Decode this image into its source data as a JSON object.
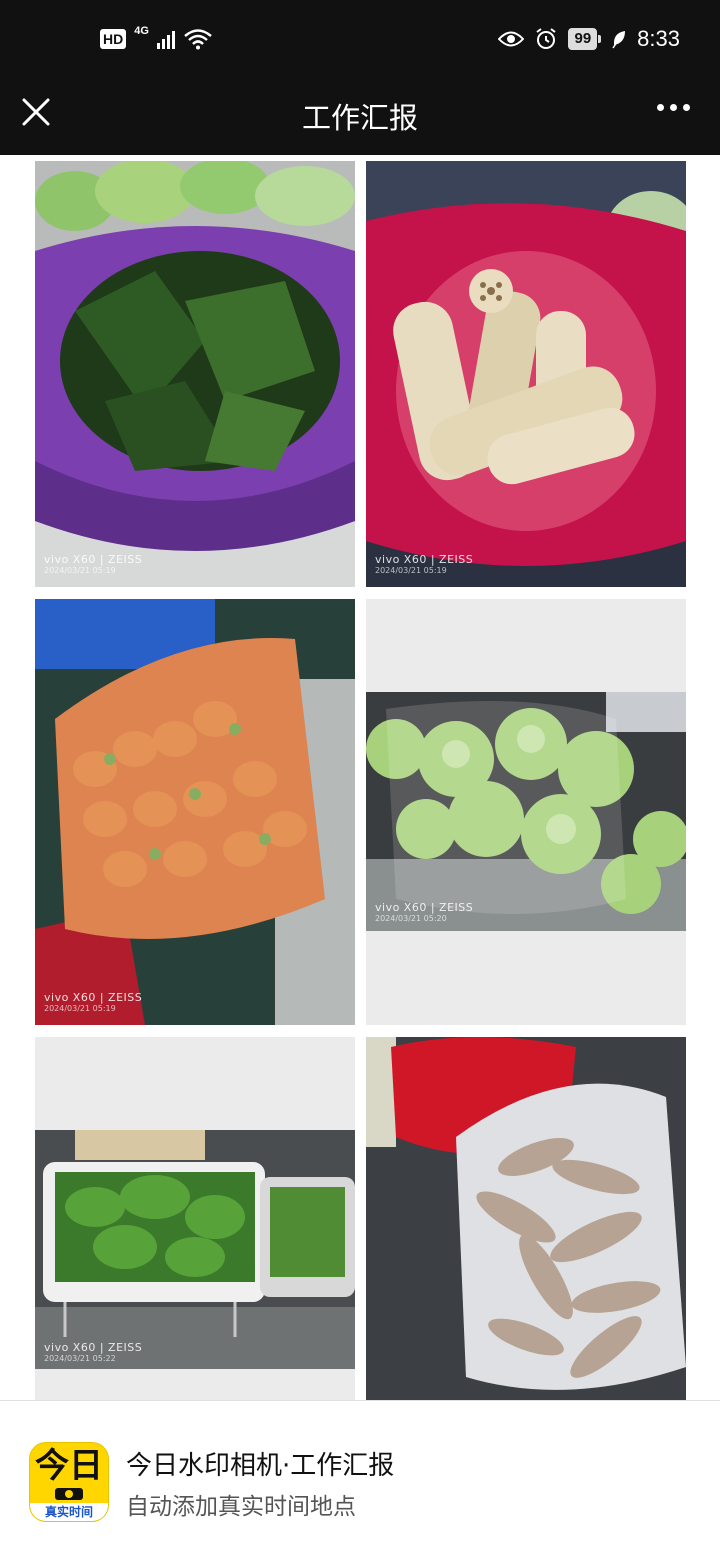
{
  "status_bar": {
    "hd": "HD",
    "network": "4G",
    "battery": "99",
    "time": "8:33"
  },
  "nav": {
    "title": "工作汇报"
  },
  "photos": [
    {
      "id": "p1",
      "model": "vivo X60 | ZEISS",
      "stamp": "2024/03/21 05:19"
    },
    {
      "id": "p2",
      "model": "vivo X60 | ZEISS",
      "stamp": "2024/03/21 05:19"
    },
    {
      "id": "p3",
      "model": "vivo X60 | ZEISS",
      "stamp": "2024/03/21 05:19"
    },
    {
      "id": "p4",
      "model": "vivo X60 | ZEISS",
      "stamp": "2024/03/21 05:20"
    },
    {
      "id": "p5",
      "model": "vivo X60 | ZEISS",
      "stamp": "2024/03/21 05:22"
    },
    {
      "id": "p6",
      "model": "",
      "stamp": ""
    }
  ],
  "banner": {
    "icon_text": "今日",
    "icon_strip": "真实时间",
    "title": "今日水印相机·工作汇报",
    "subtitle": "自动添加真实时间地点"
  },
  "colors": {
    "bar_background": "#111111",
    "icon_yellow": "#ffd600",
    "icon_blue": "#1b56c8"
  }
}
